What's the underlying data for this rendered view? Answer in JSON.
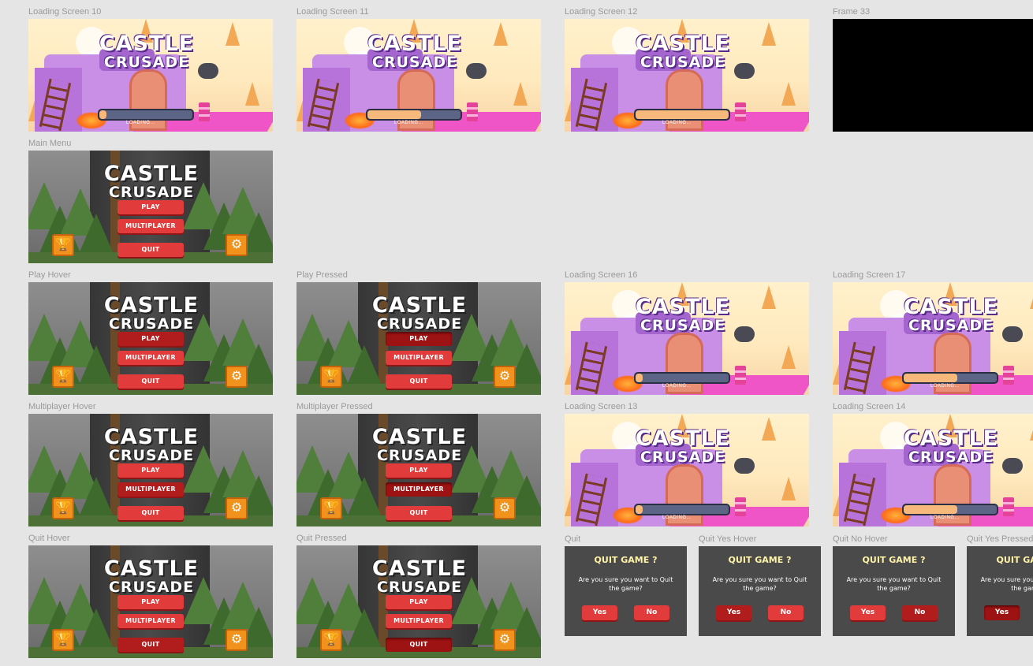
{
  "frames": {
    "ls10": "Loading Screen 10",
    "ls11": "Loading Screen 11",
    "ls12": "Loading Screen 12",
    "f33": "Frame 33",
    "main": "Main Menu",
    "play_hover": "Play Hover",
    "play_pressed": "Play Pressed",
    "ls16": "Loading Screen 16",
    "ls17": "Loading Screen 17",
    "multi_hover": "Multiplayer Hover",
    "multi_pressed": "Multiplayer Pressed",
    "ls13": "Loading Screen 13",
    "ls14": "Loading Screen 14",
    "quit_hover": "Quit Hover",
    "quit_pressed": "Quit Pressed",
    "quit": "Quit",
    "quit_yes_hover": "Quit Yes Hover",
    "quit_no_hover": "Quit No Hover",
    "quit_yes_pressed": "Quit Yes Pressed"
  },
  "game": {
    "title_line1": "CASTLE",
    "title_line2": "CRUSADE",
    "loading_text": "LOADING..."
  },
  "menu": {
    "play": "PLAY",
    "multiplayer": "MULTIPLAYER",
    "quit": "QUIT",
    "trophy_icon": "trophy-icon",
    "settings_icon": "gear-icon"
  },
  "dialog": {
    "title": "QUIT GAME ?",
    "message": "Are you sure you want to Quit the game?",
    "yes": "Yes",
    "no": "No"
  },
  "loading_progress": {
    "ls10": 0.08,
    "ls11": 0.58,
    "ls12": 1.0,
    "ls16": 0.08,
    "ls17": 0.58,
    "ls13": 0.08,
    "ls14": 0.58
  },
  "colors": {
    "canvas_bg": "#e5e5e5",
    "button_red": "#e13b3b",
    "button_hover": "#b11c1c",
    "button_pressed": "#9d1212",
    "dialog_bg": "#4a4a4a",
    "dialog_title": "#fff3a8",
    "progress_fill": "#f7b97b",
    "progress_track": "#5c6586",
    "orange_button": "#f0921c"
  }
}
